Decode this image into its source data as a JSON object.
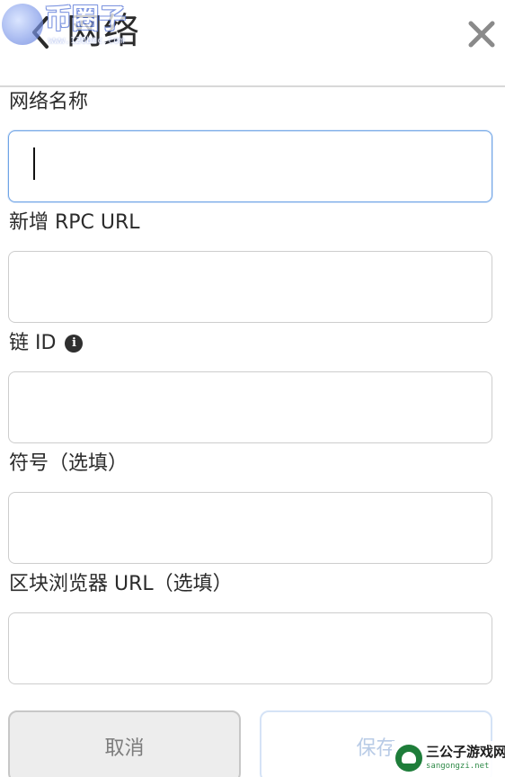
{
  "header": {
    "title": "网络",
    "back_icon": "chevron-left-icon",
    "close_icon": "close-icon"
  },
  "watermark_top": {
    "brand": "币圈子",
    "url": "www.120btc.com"
  },
  "form": {
    "fields": [
      {
        "label": "网络名称",
        "value": "",
        "focused": true
      },
      {
        "label": "新增 RPC URL",
        "value": ""
      },
      {
        "label": "链 ID",
        "value": "",
        "info_icon": "info-icon"
      },
      {
        "label": "符号（选填）",
        "value": ""
      },
      {
        "label": "区块浏览器 URL（选填）",
        "value": ""
      }
    ]
  },
  "buttons": {
    "cancel_label": "取消",
    "save_label": "保存"
  },
  "watermark_bottom": {
    "name": "三公子游戏网",
    "url": "sangongzi.net"
  },
  "colors": {
    "text": "#2b2b2b",
    "input_border": "#cdcdcd",
    "input_focus_border": "#6fa4e6",
    "cancel_bg": "#ededed",
    "save_text": "#b8cbe6"
  }
}
